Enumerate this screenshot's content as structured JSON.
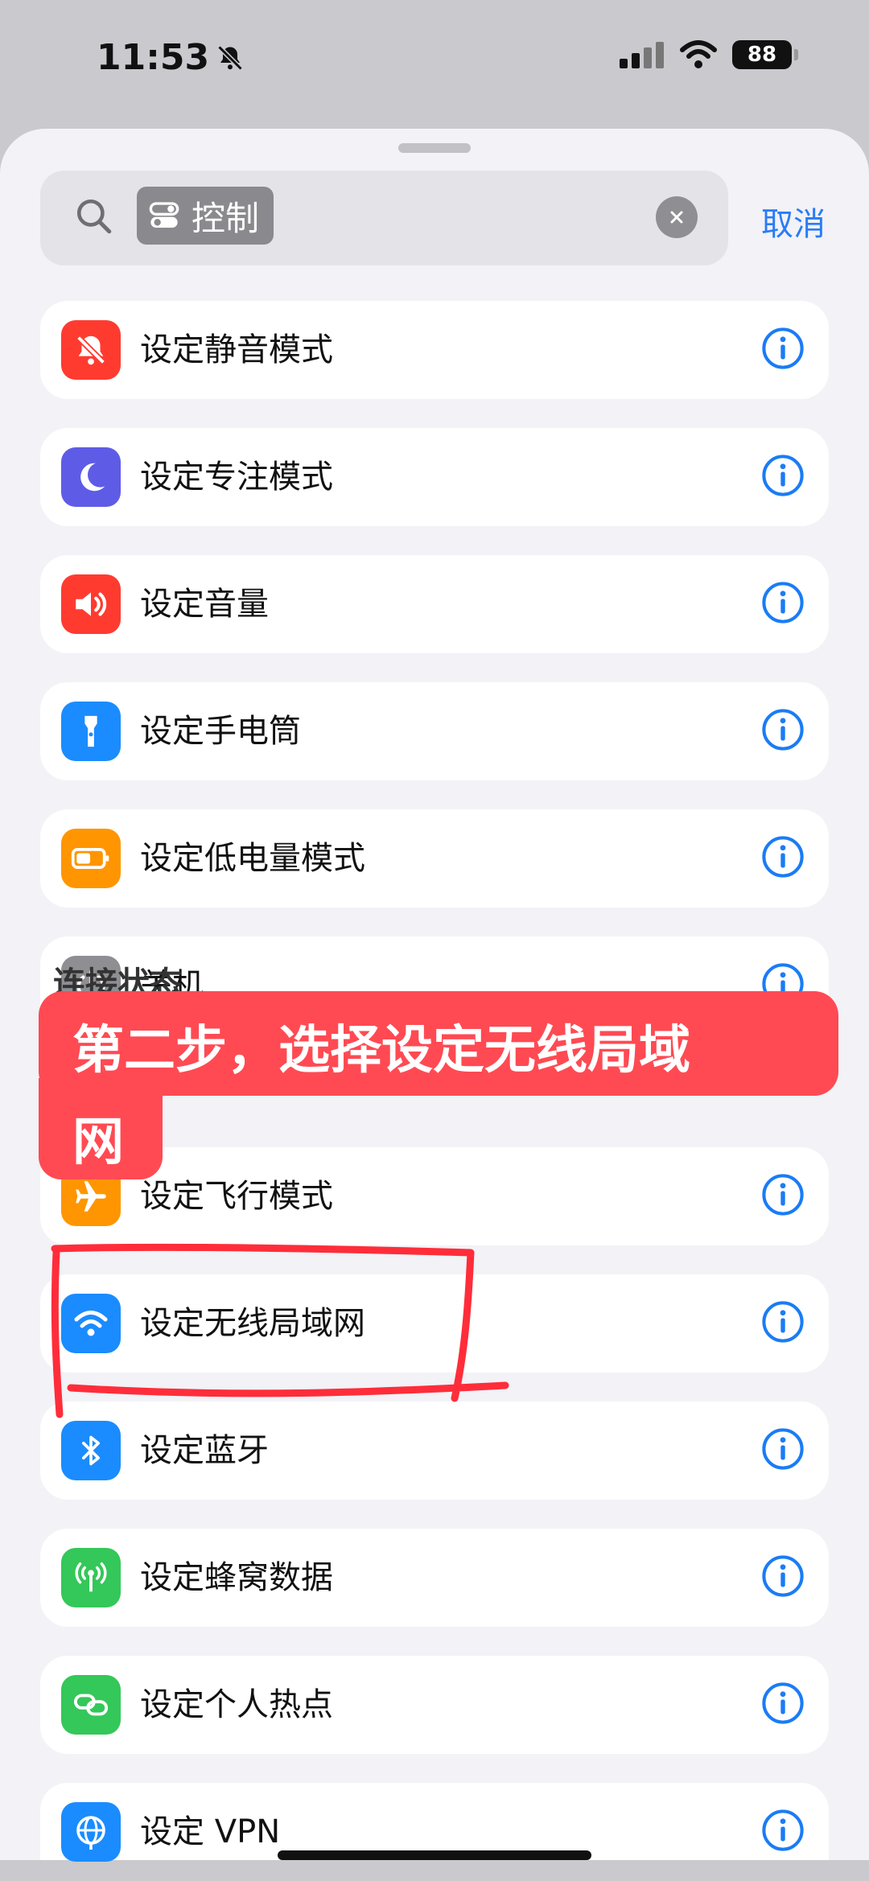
{
  "status": {
    "time": "11:53",
    "battery": "88"
  },
  "search": {
    "token_label": "控制",
    "cancel_label": "取消"
  },
  "items": [
    {
      "label": "设定静音模式",
      "icon": "bell-slash-icon",
      "color": "#ff3b30"
    },
    {
      "label": "设定专注模式",
      "icon": "moon-icon",
      "color": "#5e5ce6"
    },
    {
      "label": "设定音量",
      "icon": "speaker-icon",
      "color": "#ff3b30"
    },
    {
      "label": "设定手电筒",
      "icon": "flashlight-icon",
      "color": "#1a8cff"
    },
    {
      "label": "设定低电量模式",
      "icon": "battery-icon",
      "color": "#ff9500"
    },
    {
      "label": "关机",
      "icon": "power-icon",
      "color": "#8e8e93"
    },
    {
      "label": "设定飞行模式",
      "icon": "airplane-icon",
      "color": "#ff9500"
    },
    {
      "label": "设定无线局域网",
      "icon": "wifi-icon",
      "color": "#1a8cff"
    },
    {
      "label": "设定蓝牙",
      "icon": "bluetooth-icon",
      "color": "#1a8cff"
    },
    {
      "label": "设定蜂窝数据",
      "icon": "antenna-icon",
      "color": "#34c759"
    },
    {
      "label": "设定个人热点",
      "icon": "link-icon",
      "color": "#34c759"
    },
    {
      "label": "设定 VPN",
      "icon": "globe-icon",
      "color": "#1a8cff"
    }
  ],
  "section": {
    "header": "连接状态"
  },
  "banner": {
    "line1": "第二步，选择设定无线局域",
    "line2": "网"
  },
  "colors": {
    "accent": "#2a7cf6",
    "banner": "#ff4a53",
    "marker": "#ff2d3a"
  }
}
